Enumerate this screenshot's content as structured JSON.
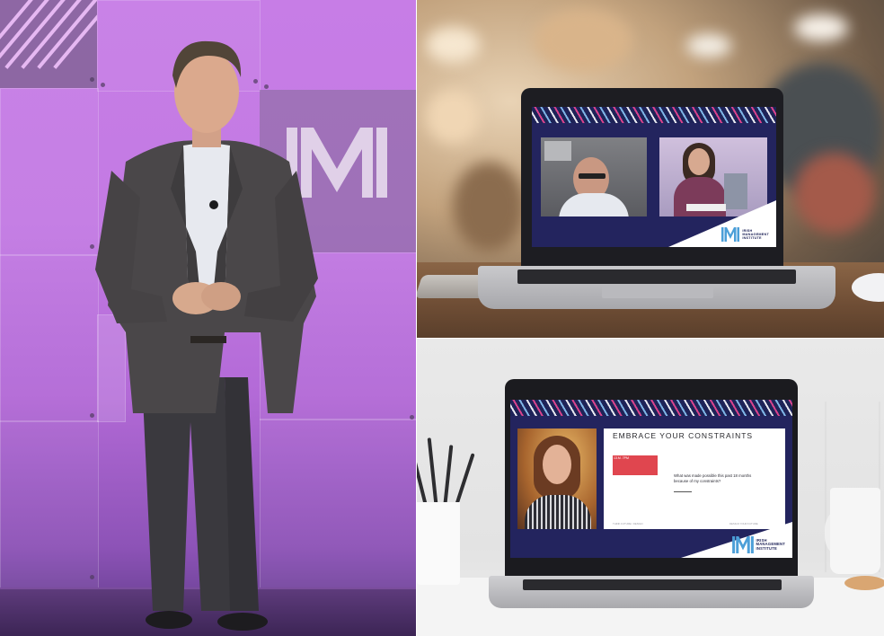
{
  "panels": {
    "stage": {
      "logo_mark": "IMI"
    },
    "laptop_call": {
      "logo_lines": [
        "IRISH",
        "MANAGEMENT",
        "INSTITUTE"
      ]
    },
    "laptop_slide": {
      "slide_title": "EMBRACE YOUR CONSTRAINTS",
      "red_box_label": "13.M. 7PM",
      "question": "What was made possible this past 18 months because of my constraints?",
      "footer_left": "THINK FUTURE / DESIGN",
      "footer_right": "DESIGN YOUR FUTURE",
      "logo_lines": [
        "IRISH",
        "MANAGEMENT",
        "INSTITUTE"
      ]
    }
  },
  "colors": {
    "stage_purple": "#c77de6",
    "brand_navy": "#1e2358",
    "brand_pink": "#d8438d",
    "brand_blue": "#7fb5e6",
    "slide_red": "#e0464f"
  }
}
